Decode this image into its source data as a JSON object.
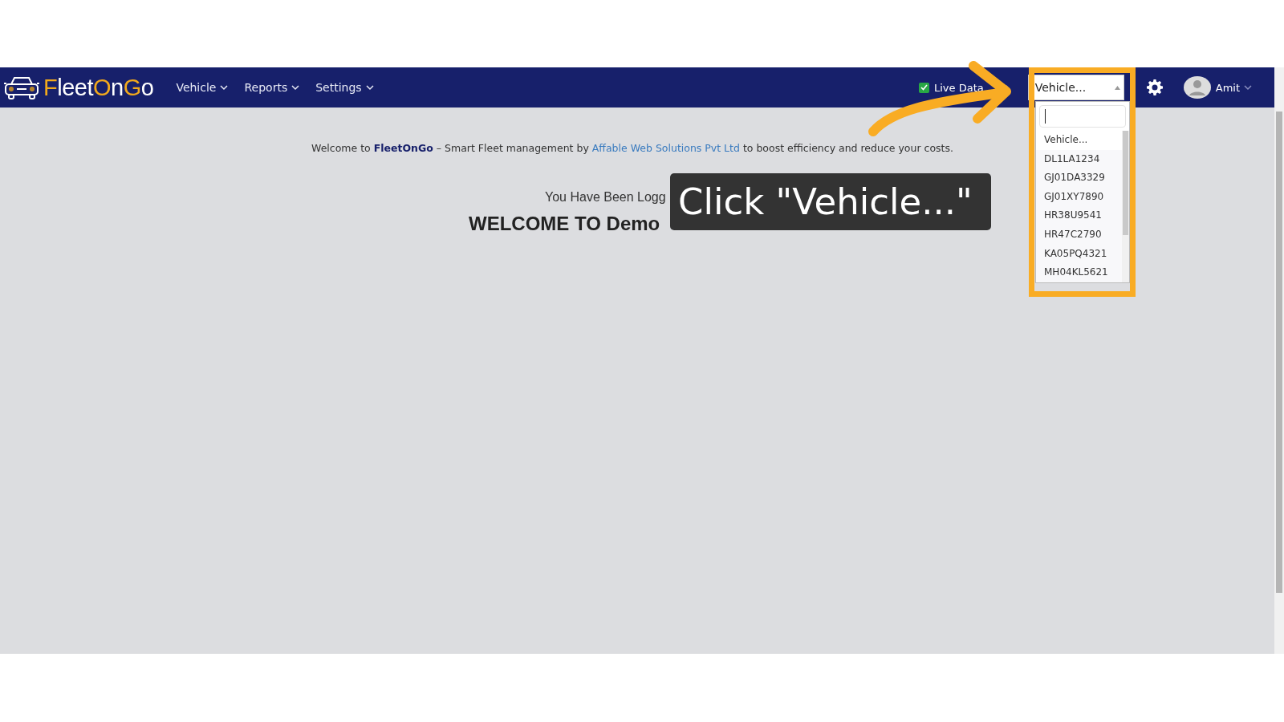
{
  "navbar": {
    "logo": [
      {
        "text": "F",
        "accent": true
      },
      {
        "text": "leet",
        "accent": false
      },
      {
        "text": "O",
        "accent": true
      },
      {
        "text": "n",
        "accent": false
      },
      {
        "text": "G",
        "accent": true
      },
      {
        "text": "o",
        "accent": false
      }
    ],
    "menus": [
      "Vehicle",
      "Reports",
      "Settings"
    ],
    "live_data": {
      "label": "Live Data",
      "checked": true
    },
    "vehicle_select": {
      "value": "Vehicle...",
      "expanded": true,
      "options": [
        {
          "label": "Vehicle...",
          "selected": true
        },
        {
          "label": "DL1LA1234",
          "selected": false
        },
        {
          "label": "GJ01DA3329",
          "selected": false
        },
        {
          "label": "GJ01XY7890",
          "selected": false
        },
        {
          "label": "HR38U9541",
          "selected": false
        },
        {
          "label": "HR47C2790",
          "selected": false
        },
        {
          "label": "KA05PQ4321",
          "selected": false
        },
        {
          "label": "MH04KL5621",
          "selected": false
        }
      ]
    },
    "user": "Amit"
  },
  "content": {
    "welcome": "Welcome to **FleetOnGo** – Smart Fleet management by ",
    "link": "Affable Web Solutions Pvt Ltd",
    "welcome_end": " to boost efficiency and reduce your costs.",
    "logged_in": "You Have Been Logg",
    "heading": "WELCOME TO Demo"
  },
  "callout": {
    "text": "Click \"Vehicle...\""
  }
}
